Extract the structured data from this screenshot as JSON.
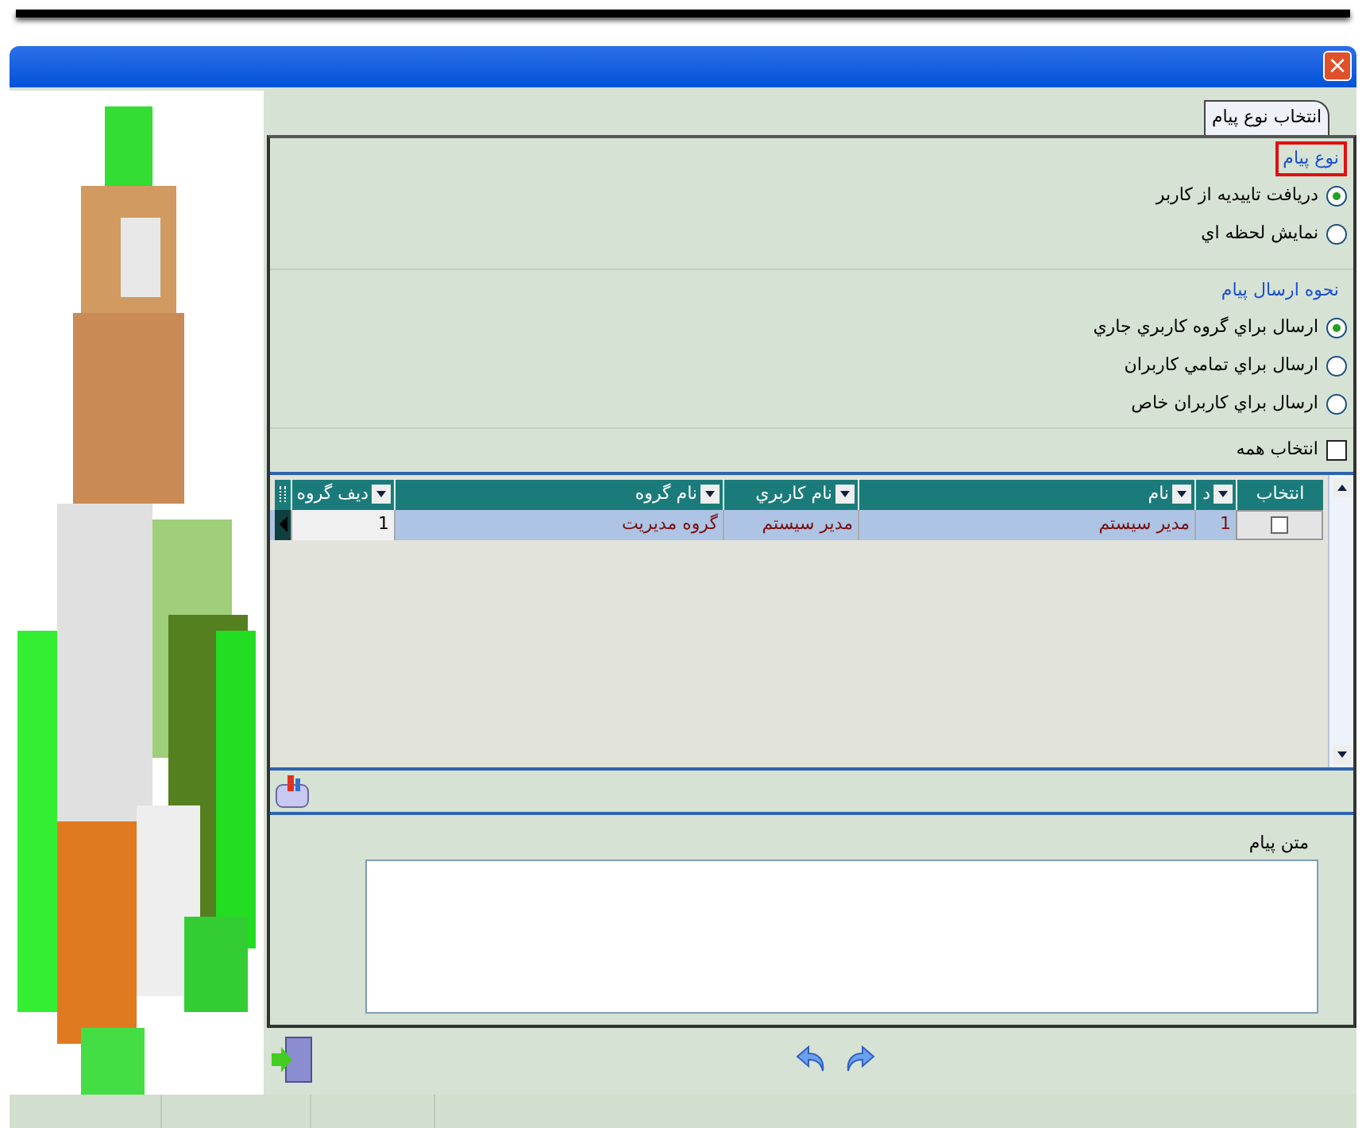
{
  "window": {
    "close": "×"
  },
  "tabs": [
    {
      "label": "انتخاب نوع پيام",
      "selected": true
    }
  ],
  "radio_groups": [
    {
      "title": "نوع پيام",
      "highlighted": true,
      "options": [
        {
          "label": "دريافت تاييديه از کاربر",
          "selected": true
        },
        {
          "label": "نمايش لحظه اي",
          "selected": false
        }
      ]
    },
    {
      "title": "نحوه ارسال پيام",
      "highlighted": false,
      "options": [
        {
          "label": "ارسال براي گروه کاربري جاري",
          "selected": true
        },
        {
          "label": "ارسال براي تمامي کاربران",
          "selected": false
        },
        {
          "label": "ارسال براي کاربران خاص",
          "selected": false
        }
      ]
    }
  ],
  "select_all": {
    "label": "انتخاب همه",
    "checked": false
  },
  "table": {
    "columns": [
      {
        "label": "انتخاب",
        "filter": false
      },
      {
        "label": "د",
        "filter": true
      },
      {
        "label": "نام",
        "filter": true
      },
      {
        "label": "نام کاربري",
        "filter": true
      },
      {
        "label": "نام گروه",
        "filter": true
      },
      {
        "label": "ديف گروه",
        "filter": true
      }
    ],
    "rows": [
      {
        "selected": true,
        "checked": false,
        "cells": [
          "",
          "1",
          "مدير سيستم",
          "مدير سيستم",
          "گروه مديريت",
          "1"
        ]
      }
    ]
  },
  "message": {
    "label": "متن پيام"
  }
}
